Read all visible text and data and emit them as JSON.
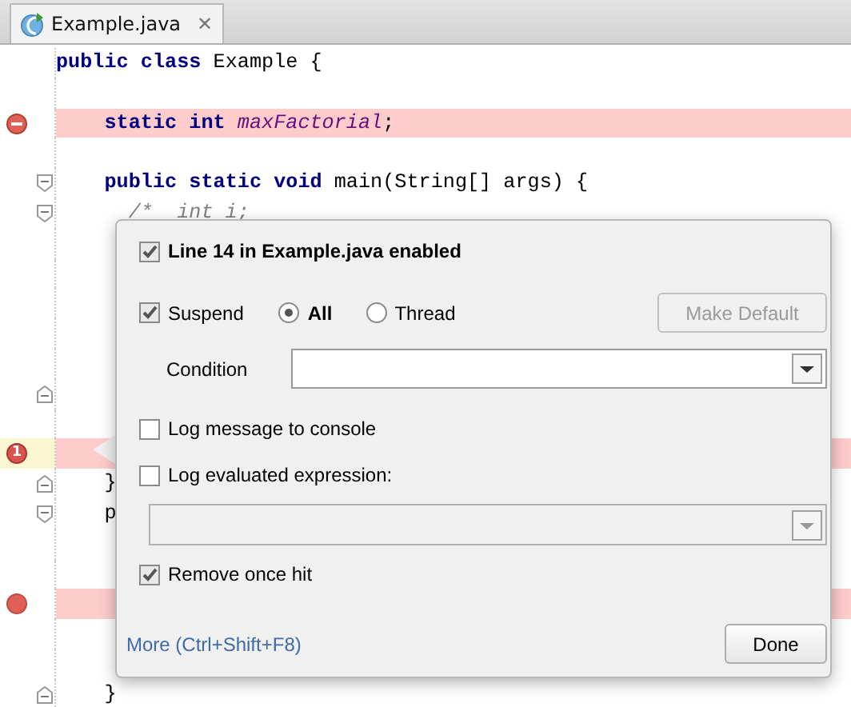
{
  "tabs": [
    {
      "label": "Example.java",
      "close": "✕",
      "selected": true
    }
  ],
  "editor": {
    "lines": [
      {
        "text": "**public** **class** Example {",
        "highlighted": false,
        "selected": false
      },
      {
        "highlighted": false,
        "selected": false
      },
      {
        "text": "    **static** **int** *maxFactorial*;",
        "breakpoint": {
          "kind": "field"
        },
        "highlighted": true,
        "selected": false
      },
      {
        "highlighted": false,
        "selected": false
      },
      {
        "text": "    **public** **static** **void** main(String[] args) {",
        "fold": {
          "kind": "start"
        },
        "highlighted": false,
        "selected": false
      },
      {
        "text": "      /*  int i;",
        "kind": "comment",
        "fold": {
          "kind": "start"
        },
        "highlighted": false,
        "selected": false
      },
      {
        "highlighted": false,
        "selected": false
      },
      {
        "highlighted": false,
        "selected": false
      },
      {
        "highlighted": false,
        "selected": false
      },
      {
        "highlighted": false,
        "selected": false
      },
      {
        "highlighted": false,
        "selected": false
      },
      {
        "fold": {
          "kind": "end"
        },
        "highlighted": false,
        "selected": false
      },
      {
        "highlighted": false,
        "selected": false
      },
      {
        "breakpoint": {
          "kind": "numbered",
          "badge": "1"
        },
        "highlighted": true,
        "selected": true
      },
      {
        "text": "    }",
        "fold": {
          "kind": "end"
        },
        "highlighted": false,
        "selected": false
      },
      {
        "text": "    p",
        "fold": {
          "kind": "start"
        },
        "highlighted": false,
        "selected": false
      },
      {
        "highlighted": false,
        "selected": false
      },
      {
        "highlighted": false,
        "selected": false
      },
      {
        "breakpoint": {
          "kind": "line"
        },
        "highlighted": true,
        "selected": false
      },
      {
        "highlighted": false,
        "selected": false
      },
      {
        "highlighted": false,
        "selected": false
      },
      {
        "text": "    }",
        "fold": {
          "kind": "end"
        },
        "highlighted": false,
        "selected": false
      }
    ]
  },
  "popup": {
    "title": {
      "label": "Line 14 in Example.java enabled",
      "checked": true
    },
    "suspend": {
      "label": "Suspend",
      "checked": true
    },
    "suspend_policy": [
      {
        "label": "All",
        "selected": true
      },
      {
        "label": "Thread",
        "selected": false
      }
    ],
    "make_default": {
      "label": "Make Default",
      "disabled": true
    },
    "condition": {
      "label": "Condition"
    },
    "log_message": {
      "label": "Log message to console",
      "checked": false
    },
    "log_expression": {
      "label": "Log evaluated expression:",
      "checked": false
    },
    "expression_field": {
      "disabled": true
    },
    "remove_once_hit": {
      "label": "Remove once hit",
      "checked": true
    },
    "more_link": "More (Ctrl+Shift+F8)",
    "done": "Done"
  }
}
